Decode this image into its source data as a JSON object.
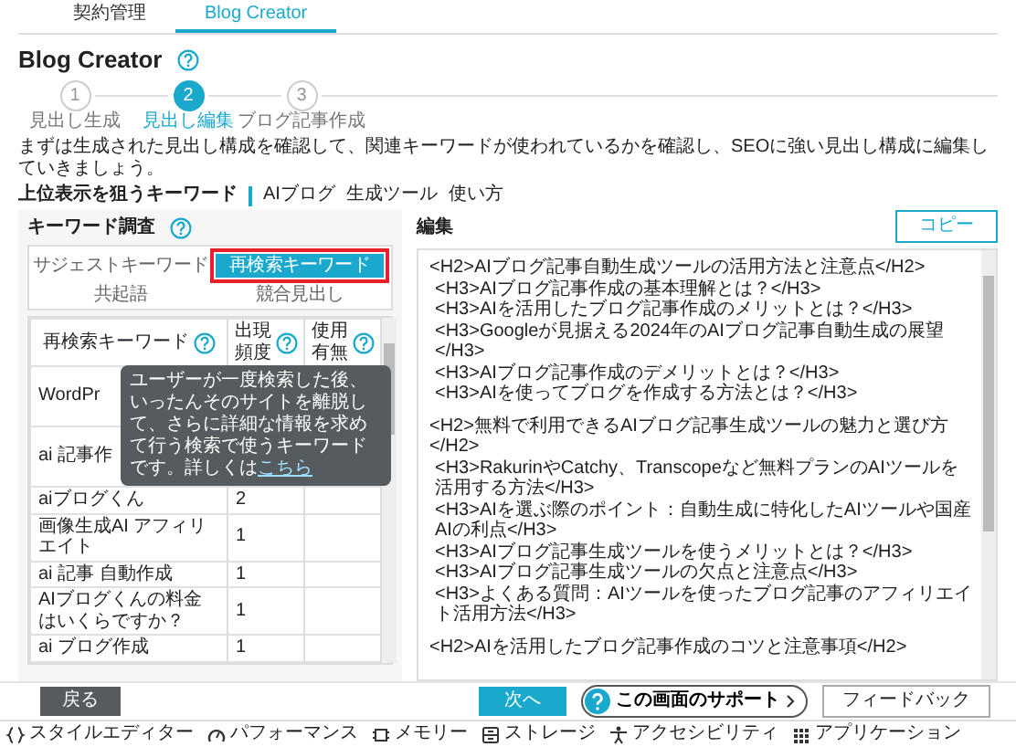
{
  "tabs": [
    {
      "label": "契約管理",
      "selected": false
    },
    {
      "label": "Blog Creator",
      "selected": true
    }
  ],
  "page_title": "Blog Creator",
  "steps": [
    {
      "number": "1",
      "label": "見出し生成",
      "selected": false
    },
    {
      "number": "2",
      "label": "見出し編集",
      "selected": true
    },
    {
      "number": "3",
      "label": "ブログ記事作成",
      "selected": false
    }
  ],
  "description": "まずは生成された見出し構成を確認して、関連キーワードが使われているかを確認し、SEOに強い見出し構成に編集していきましょう。",
  "target_keywords": {
    "label": "上位表示を狙うキーワード",
    "keywords": [
      "AIブログ",
      "生成ツール",
      "使い方"
    ]
  },
  "keyword_panel": {
    "title": "キーワード調査",
    "segments": [
      {
        "label": "サジェストキーワード",
        "selected": false
      },
      {
        "label": "再検索キーワード",
        "selected": true
      },
      {
        "label": "共起語",
        "selected": false
      },
      {
        "label": "競合見出し",
        "selected": false
      }
    ],
    "columns": [
      "再検索キーワード",
      "出現頻度",
      "使用有無"
    ],
    "rows": [
      {
        "keyword": "WordPr"
      },
      {
        "keyword": "ai 記事作"
      },
      {
        "keyword": "aiブログくん",
        "frequency": "2"
      },
      {
        "keyword": "画像生成AI アフィリエイト",
        "frequency": "1"
      },
      {
        "keyword": "ai 記事 自動作成",
        "frequency": "1"
      },
      {
        "keyword": "AIブログくんの料金はいくらですか？",
        "frequency": "1"
      },
      {
        "keyword": "ai ブログ作成",
        "frequency": "1"
      }
    ],
    "tooltip": {
      "text": "ユーザーが一度検索した後、いったんそのサイトを離脱して、さらに詳細な情報を求めて行う検索で使うキーワードです。詳しくは",
      "link": "こちら"
    }
  },
  "editor": {
    "title": "編集",
    "copy_button": "コピー",
    "sections": [
      {
        "heading": "<H2>AIブログ記事自動生成ツールの活用方法と注意点</H2>",
        "subheadings": [
          "<H3>AIブログ記事作成の基本理解とは？</H3>",
          "<H3>AIを活用したブログ記事作成のメリットとは？</H3>",
          "<H3>Googleが見据える2024年のAIブログ記事自動生成の展望</H3>",
          "<H3>AIブログ記事作成のデメリットとは？</H3>",
          "<H3>AIを使ってブログを作成する方法とは？</H3>"
        ]
      },
      {
        "heading": "<H2>無料で利用できるAIブログ記事生成ツールの魅力と選び方</H2>",
        "subheadings": [
          "<H3>RakurinやCatchy、Transcopeなど無料プランのAIツールを活用する方法</H3>",
          "<H3>AIを選ぶ際のポイント：自動生成に特化したAIツールや国産AIの利点</H3>",
          "<H3>AIブログ記事生成ツールを使うメリットとは？</H3>",
          "<H3>AIブログ記事生成ツールの欠点と注意点</H3>",
          "<H3>よくある質問：AIツールを使ったブログ記事のアフィリエイト活用方法</H3>"
        ]
      },
      {
        "heading": "<H2>AIを活用したブログ記事作成のコツと注意事項</H2>"
      }
    ]
  },
  "footer": {
    "back_button": "戻る",
    "next_button": "次へ",
    "support_button": "この画面のサポート",
    "feedback_button": "フィードバック"
  },
  "devtools_tabs": [
    {
      "kind": "braces",
      "label": "スタイルエディター"
    },
    {
      "kind": "gauge",
      "label": "パフォーマンス"
    },
    {
      "kind": "chip",
      "label": "メモリー"
    },
    {
      "kind": "storage",
      "label": "ストレージ"
    },
    {
      "kind": "person",
      "label": "アクセシビリティ"
    },
    {
      "kind": "grid",
      "label": "アプリケーション"
    }
  ]
}
